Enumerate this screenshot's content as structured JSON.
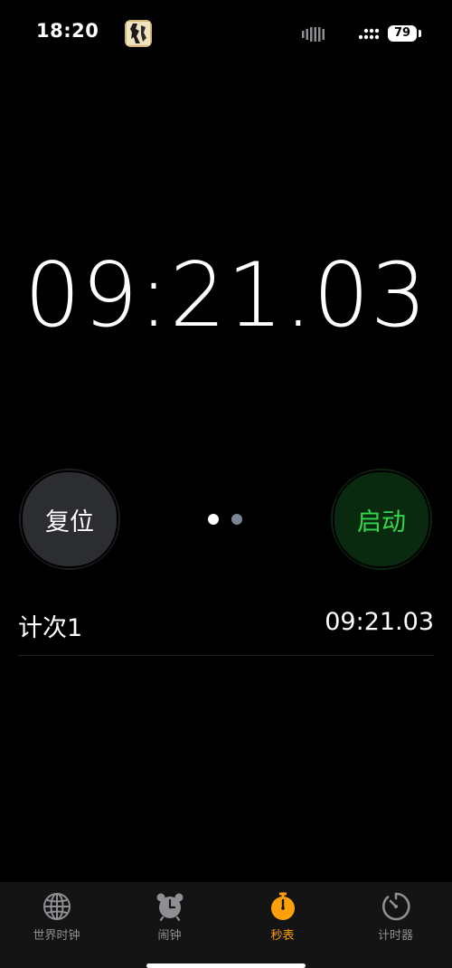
{
  "status_bar": {
    "time": "18:20",
    "battery": "79",
    "icons": [
      "app-thumbnail-icon",
      "voice-bars-icon",
      "signal-icon",
      "battery-icon"
    ]
  },
  "stopwatch": {
    "time": "09:21.03"
  },
  "buttons": {
    "reset_label": "复位",
    "start_label": "启动"
  },
  "page_indicator": {
    "pages": 2,
    "active": 1
  },
  "laps": [
    {
      "label": "计次1",
      "time": "09:21.03"
    }
  ],
  "tab_bar": {
    "items": [
      {
        "label": "世界时钟",
        "icon": "globe-icon"
      },
      {
        "label": "闹钟",
        "icon": "alarm-clock-icon"
      },
      {
        "label": "秒表",
        "icon": "stopwatch-icon",
        "active": true
      },
      {
        "label": "计时器",
        "icon": "timer-icon"
      }
    ]
  },
  "colors": {
    "background": "#000000",
    "start_green": "#32d74b",
    "active_tab_orange": "#ff9f0a",
    "inactive_tab_gray": "#8e8e93"
  }
}
